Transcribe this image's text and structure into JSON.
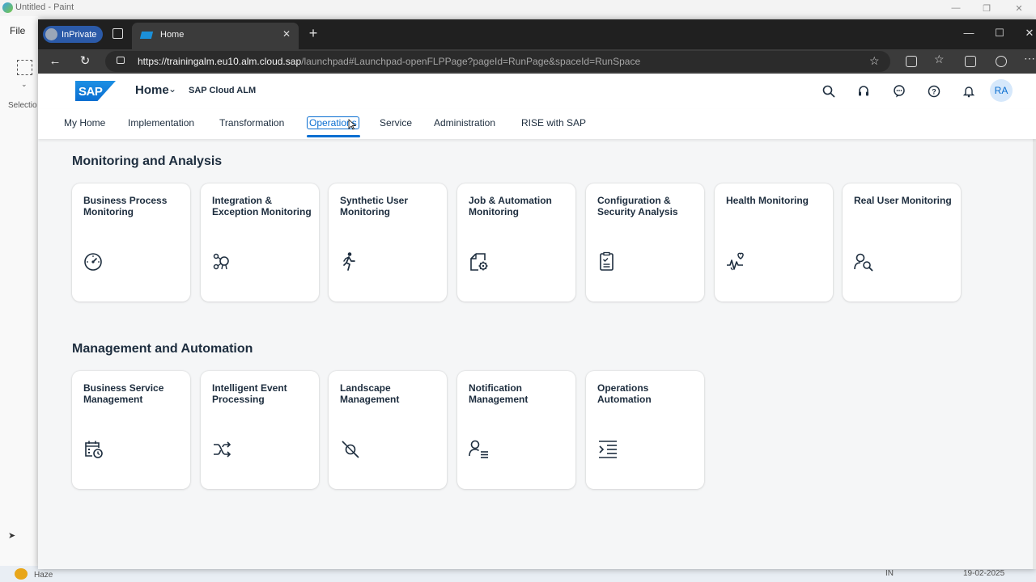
{
  "paint": {
    "window_title": "Untitled - Paint",
    "menu_file": "File",
    "selection_label": "Selectio",
    "taskbar_weather": "Haze",
    "taskbar_lang": "IN",
    "taskbar_date": "19-02-2025"
  },
  "browser": {
    "inprivate_label": "InPrivate",
    "tab_title": "Home",
    "url_host": "https://trainingalm.eu10.alm.cloud.sap",
    "url_path": "/launchpad#Launchpad-openFLPPage?pageId=RunPage&spaceId=RunSpace"
  },
  "shell": {
    "logo_text": "SAP",
    "home_title": "Home",
    "product_name": "SAP Cloud ALM",
    "avatar_initials": "RA"
  },
  "spaces": [
    {
      "label": "My Home",
      "active": false
    },
    {
      "label": "Implementation",
      "active": false
    },
    {
      "label": "Transformation",
      "active": false
    },
    {
      "label": "Operations",
      "active": true
    },
    {
      "label": "Service",
      "active": false
    },
    {
      "label": "Administration",
      "active": false
    },
    {
      "label": "RISE with SAP",
      "active": false
    }
  ],
  "sections": [
    {
      "title": "Monitoring and Analysis",
      "tiles": [
        {
          "title": "Business Process Monitoring",
          "icon": "gauge-icon"
        },
        {
          "title": "Integration & Exception Monitoring",
          "icon": "integration-network-icon"
        },
        {
          "title": "Synthetic User Monitoring",
          "icon": "running-person-icon"
        },
        {
          "title": "Job & Automation Monitoring",
          "icon": "job-gear-icon"
        },
        {
          "title": "Configuration & Security Analysis",
          "icon": "checklist-icon"
        },
        {
          "title": "Health Monitoring",
          "icon": "heart-pulse-icon"
        },
        {
          "title": "Real User Monitoring",
          "icon": "user-search-icon"
        }
      ]
    },
    {
      "title": "Management and Automation",
      "tiles": [
        {
          "title": "Business Service Management",
          "icon": "calendar-clock-icon"
        },
        {
          "title": "Intelligent Event Processing",
          "icon": "shuffle-icon"
        },
        {
          "title": "Landscape Management",
          "icon": "plug-icon"
        },
        {
          "title": "Notification Management",
          "icon": "user-list-icon"
        },
        {
          "title": "Operations Automation",
          "icon": "indent-list-icon"
        }
      ]
    }
  ],
  "colors": {
    "accent": "#0a6ed1",
    "shell_bg": "#ffffff",
    "content_bg": "#f5f6f7",
    "browser_chrome": "#202020"
  }
}
